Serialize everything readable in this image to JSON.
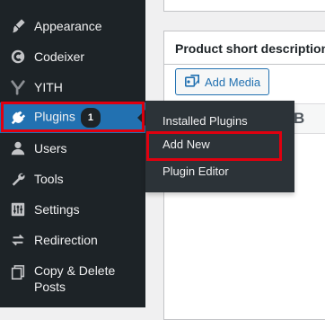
{
  "sidebar": {
    "items": [
      {
        "label": "Appearance",
        "icon": "paintbrush-icon"
      },
      {
        "label": "Codeixer",
        "icon": "codeixer-icon"
      },
      {
        "label": "YITH",
        "icon": "yith-icon"
      },
      {
        "label": "Plugins",
        "icon": "plugin-icon",
        "badge": "1",
        "active": true
      },
      {
        "label": "Users",
        "icon": "users-icon"
      },
      {
        "label": "Tools",
        "icon": "wrench-icon"
      },
      {
        "label": "Settings",
        "icon": "settings-sliders-icon"
      },
      {
        "label": "Redirection",
        "icon": "redirection-icon"
      },
      {
        "label_line1": "Copy & Delete",
        "label_line2": "Posts",
        "icon": "copy-icon"
      }
    ]
  },
  "flyout": {
    "items": [
      {
        "label": "Installed Plugins"
      },
      {
        "label": "Add New",
        "highlighted": true
      },
      {
        "label": "Plugin Editor"
      }
    ]
  },
  "panel": {
    "title": "Product short description",
    "add_media_label": "Add Media",
    "bold_label": "B"
  },
  "colors": {
    "sidebar_bg": "#1d2327",
    "active_bg": "#2271b1",
    "flyout_bg": "#2c3338",
    "highlight_border": "#e0000f",
    "link_blue": "#2271b1"
  }
}
